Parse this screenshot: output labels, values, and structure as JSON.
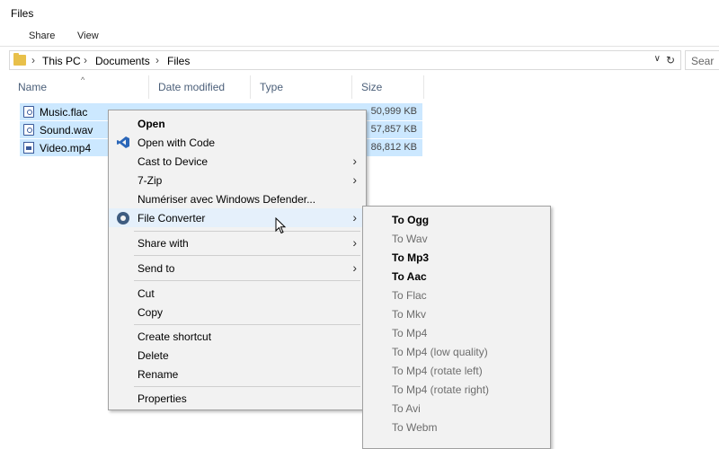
{
  "window": {
    "title": "Files"
  },
  "ribbon": {
    "tabs": [
      "Share",
      "View"
    ]
  },
  "address": {
    "crumbs": [
      "This PC",
      "Documents",
      "Files"
    ],
    "search_placeholder": "Sear"
  },
  "columns": {
    "name": "Name",
    "date": "Date modified",
    "type": "Type",
    "size": "Size"
  },
  "files": [
    {
      "name": "Music.flac",
      "size": "50,999 KB",
      "icon": "audio-file-icon"
    },
    {
      "name": "Sound.wav",
      "size": "57,857 KB",
      "icon": "audio-file-icon"
    },
    {
      "name": "Video.mp4",
      "size": "86,812 KB",
      "icon": "video-file-icon"
    }
  ],
  "context_menu": {
    "open": "Open",
    "open_with_code": "Open with Code",
    "cast": "Cast to Device",
    "zip": "7-Zip",
    "defender": "Numériser avec Windows Defender...",
    "file_converter": "File Converter",
    "share_with": "Share with",
    "send_to": "Send to",
    "cut": "Cut",
    "copy": "Copy",
    "create_shortcut": "Create shortcut",
    "delete": "Delete",
    "rename": "Rename",
    "properties": "Properties"
  },
  "submenu": {
    "items": [
      {
        "label": "To Ogg",
        "enabled": true
      },
      {
        "label": "To Wav",
        "enabled": false
      },
      {
        "label": "To Mp3",
        "enabled": true
      },
      {
        "label": "To Aac",
        "enabled": true
      },
      {
        "label": "To Flac",
        "enabled": false
      },
      {
        "label": "To Mkv",
        "enabled": false
      },
      {
        "label": "To Mp4",
        "enabled": false
      },
      {
        "label": "To Mp4 (low quality)",
        "enabled": false
      },
      {
        "label": "To Mp4 (rotate left)",
        "enabled": false
      },
      {
        "label": "To Mp4 (rotate right)",
        "enabled": false
      },
      {
        "label": "To Avi",
        "enabled": false
      },
      {
        "label": "To Webm",
        "enabled": false
      }
    ]
  },
  "colors": {
    "selection": "#cce8ff",
    "menu_bg": "#f2f2f2",
    "hover": "#e5f0fb"
  }
}
